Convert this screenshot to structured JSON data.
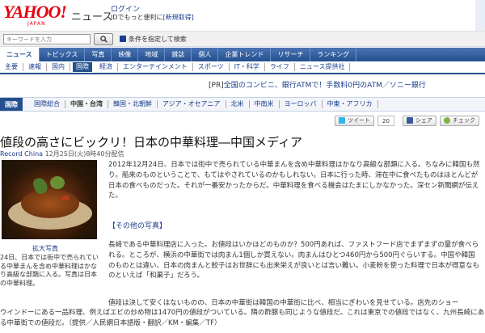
{
  "header": {
    "logo_text": "YAHOO!",
    "logo_sub": "JAPAN",
    "site_title": "ニュース",
    "login_label": "ログイン",
    "id_note": "IDでもっと便利に",
    "signup_label": "[新規取得]"
  },
  "search": {
    "placeholder": "キーワードを入力",
    "adv_label": "条件を指定して検索"
  },
  "main_tabs": [
    "ニュース",
    "トピックス",
    "写真",
    "映像",
    "地域",
    "雑誌",
    "個人",
    "企業トレンド",
    "リサーチ",
    "ランキング"
  ],
  "sub_nav": [
    "主要",
    "速報",
    "国内",
    "国際",
    "経済",
    "エンターテインメント",
    "スポーツ",
    "IT・科学",
    "ライフ",
    "ニュース提供社"
  ],
  "pr": {
    "tag": "[PR]",
    "text": "全国のコンビニ、銀行ATMで！手数料0円のATM／ソニー銀行"
  },
  "region_nav": {
    "label": "国際",
    "items": [
      "国際総合",
      "中国・台湾",
      "韓国・北朝鮮",
      "アジア・オセアニア",
      "北米",
      "中南米",
      "ヨーロッパ",
      "中東・アフリカ"
    ]
  },
  "share": {
    "tweet": "ツイート",
    "tweet_count": "20",
    "facebook": "シェア",
    "check": "チェック"
  },
  "article": {
    "headline": "値段の高さにビックリ！日本の中華料理―中国メディア",
    "source": "Record China",
    "date": "12月25日(火)8時40分配信",
    "enlarge": "拡大写真",
    "caption": "24日、日本では街中で売られている中華まんを含め中華料理はかなり高級な部類に入る。写真は日本の中華料理。",
    "para1": "2012年12月24日、日本では街中で売られている中華まんを含め中華料理はかなり高級な部類に入る。ちなみに韓国も然り。船来のものということで、もてはやされているのかもしれない。日本に行った時、滞在中に食べたものはほとんどが日本の食べものだった。それが一番安かったからだ。中華料理を食べる機会はたまにしかなかった。深セン新聞網が伝えた。",
    "other_photos": "【その他の写真】",
    "para2": "長崎である中華料理店に入った。お値段はいかほどのものか？500円あれば、ファストフード店でまずまずの量が食べられる。ところが、横浜の中華街では肉まん1個しか買えない。肉まんはひとつ460円から500円ぐらいする。中国や韓国のものとは違い、日本の肉まんと餃子はお世辞にも出来栄えが良いとは言い難い。小麦粉を使った料理で日本が得意なものといえば「和菓子」だろう。",
    "para3": "値段は決して安くはないものの、日本の中華街は韓国の中華街に比べ、相当にぎわいを見せている。店先のショー",
    "para4": "ウインドーにある一品料理、例えばエビの炒め物は1470円の値段がついている。隣の酢豚も同じような値段だ。これは東京での値段ではなく、九州長崎にある中華街での値段だ。（提供／人民網日本語版・翻訳／KM・編集／TF）"
  },
  "colors": {
    "brand_red": "#e60012",
    "nav_blue": "#24508f",
    "link_blue": "#1a3d8c"
  }
}
